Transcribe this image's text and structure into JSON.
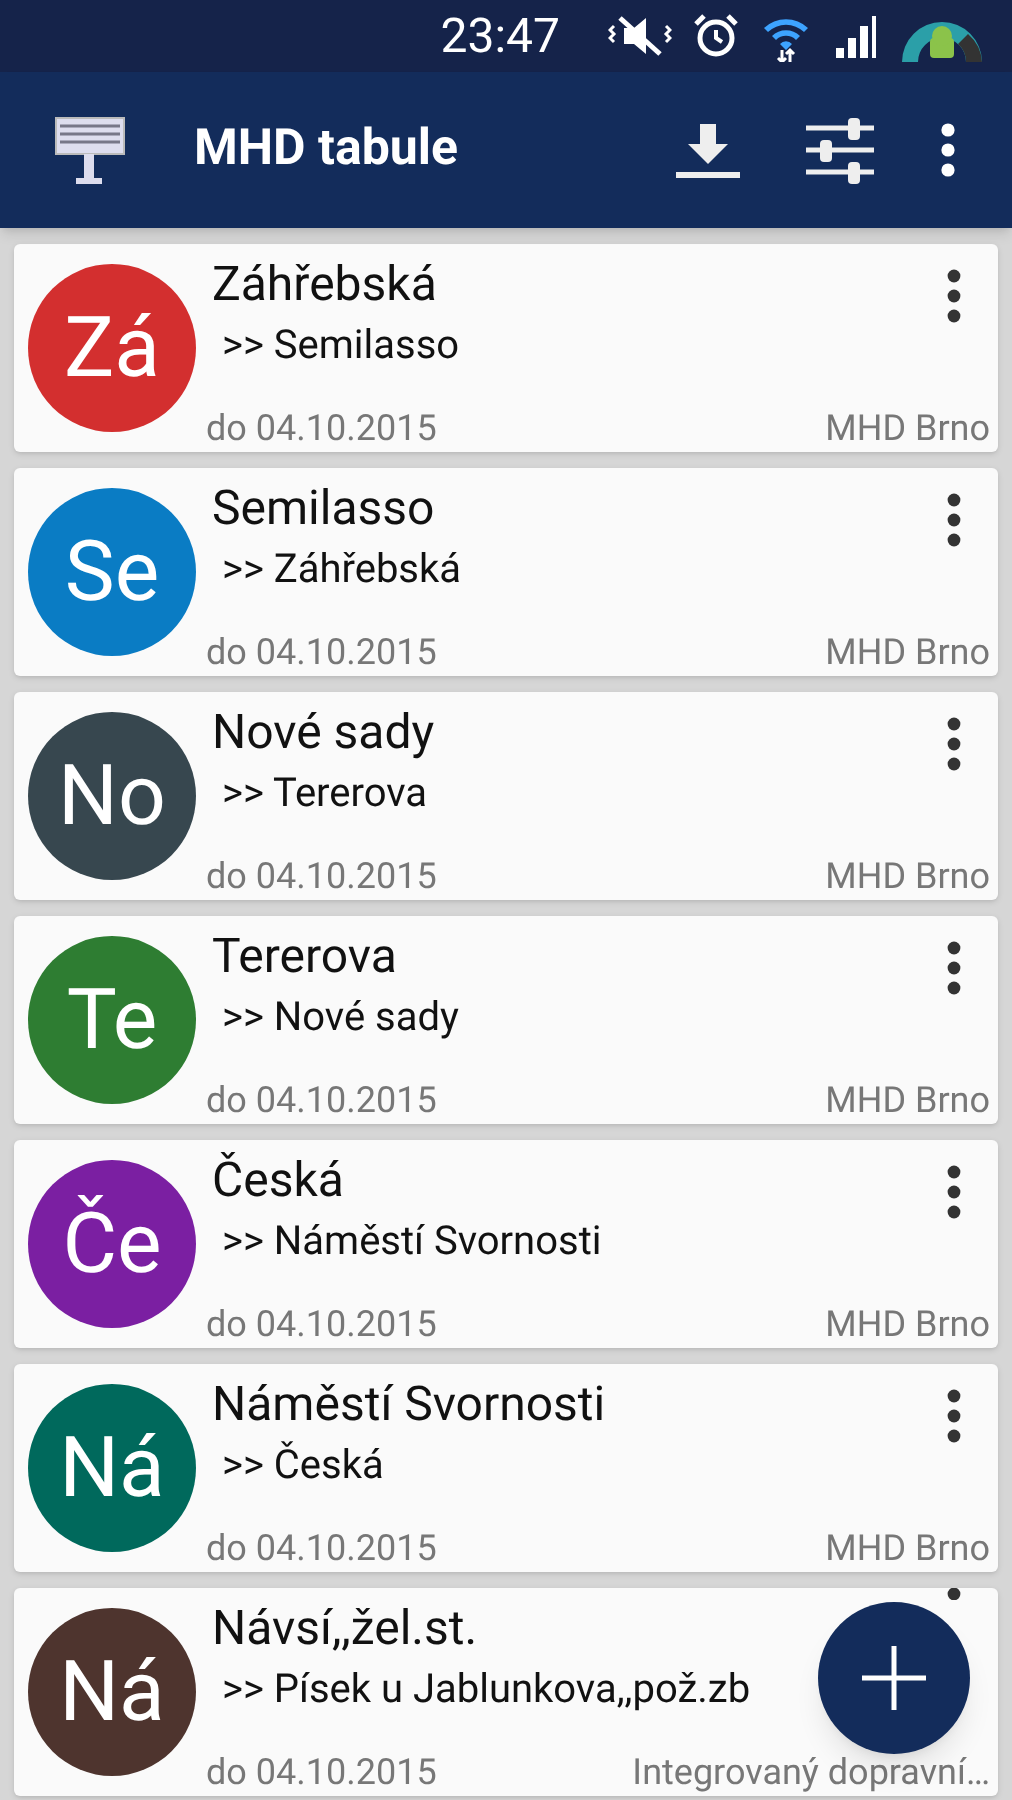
{
  "status_bar": {
    "time": "23:47"
  },
  "app_bar": {
    "title": "MHD tabule"
  },
  "boards": [
    {
      "initials": "Zá",
      "color": "#d32f2f",
      "title": "Záhřebská",
      "direction": ">> Semilasso",
      "valid": "do 04.10.2015",
      "operator": "MHD Brno"
    },
    {
      "initials": "Se",
      "color": "#0a7cc4",
      "title": "Semilasso",
      "direction": ">> Záhřebská",
      "valid": "do 04.10.2015",
      "operator": "MHD Brno"
    },
    {
      "initials": "No",
      "color": "#37474f",
      "title": "Nové sady",
      "direction": ">> Tererova",
      "valid": "do 04.10.2015",
      "operator": "MHD Brno"
    },
    {
      "initials": "Te",
      "color": "#2e7d32",
      "title": "Tererova",
      "direction": ">> Nové sady",
      "valid": "do 04.10.2015",
      "operator": "MHD Brno"
    },
    {
      "initials": "Če",
      "color": "#7b1fa2",
      "title": "Česká",
      "direction": ">> Náměstí Svornosti",
      "valid": "do 04.10.2015",
      "operator": "MHD Brno"
    },
    {
      "initials": "Ná",
      "color": "#00695c",
      "title": "Náměstí Svornosti",
      "direction": ">> Česká",
      "valid": "do 04.10.2015",
      "operator": "MHD Brno"
    },
    {
      "initials": "Ná",
      "color": "#4e342e",
      "title": "Návsí,,žel.st.",
      "direction": ">> Písek u Jablunkova,,pož.zb",
      "valid": "do 04.10.2015",
      "operator": "Integrovaný dopravní…"
    }
  ]
}
